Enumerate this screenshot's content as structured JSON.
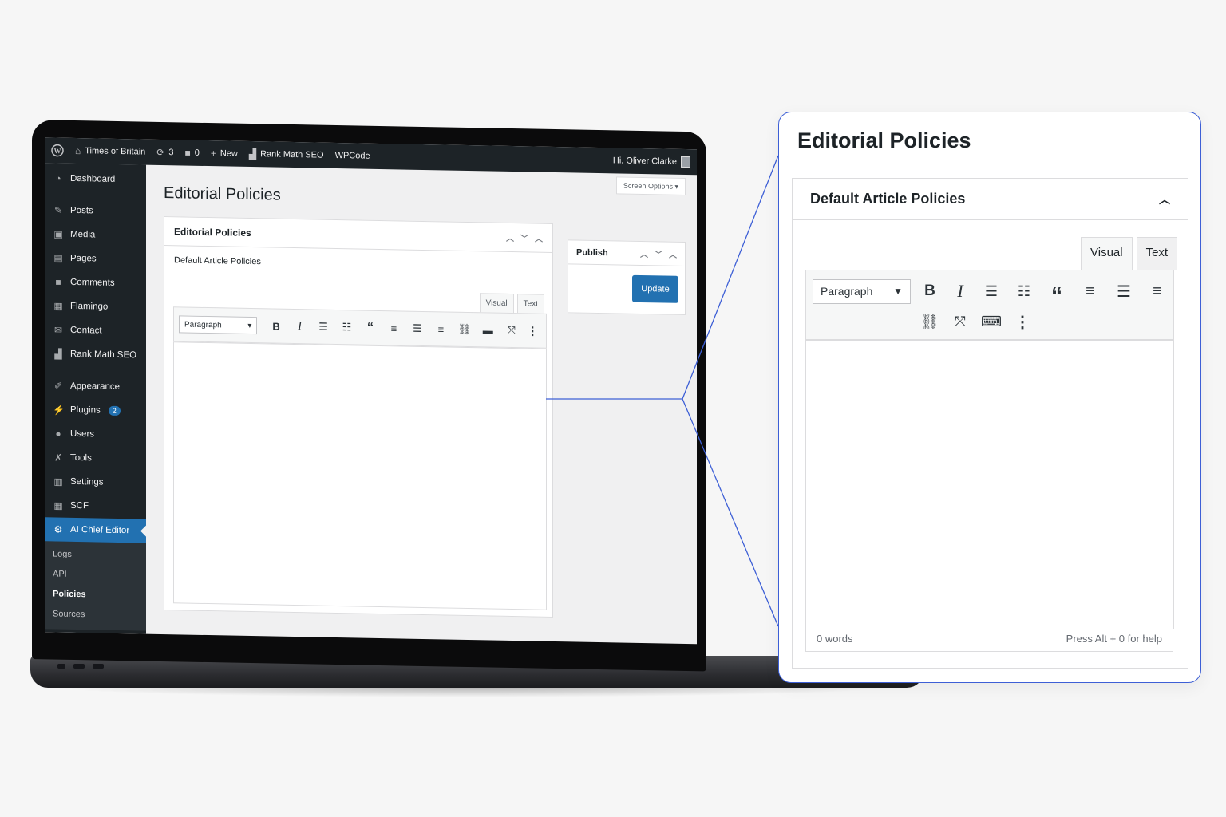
{
  "admin_bar": {
    "site_name": "Times of Britain",
    "updates_count": "3",
    "comments_count": "0",
    "new_label": "New",
    "rank_math_label": "Rank Math SEO",
    "wpcode_label": "WPCode",
    "greeting": "Hi, Oliver Clarke"
  },
  "sidebar": {
    "items": [
      {
        "label": "Dashboard",
        "icon": "dashboard-icon"
      },
      {
        "label": "Posts",
        "icon": "pin-icon"
      },
      {
        "label": "Media",
        "icon": "media-icon"
      },
      {
        "label": "Pages",
        "icon": "page-icon"
      },
      {
        "label": "Comments",
        "icon": "comment-icon"
      },
      {
        "label": "Flamingo",
        "icon": "flamingo-icon"
      },
      {
        "label": "Contact",
        "icon": "mail-icon"
      },
      {
        "label": "Rank Math SEO",
        "icon": "chart-icon"
      },
      {
        "label": "Appearance",
        "icon": "brush-icon"
      },
      {
        "label": "Plugins",
        "icon": "plug-icon",
        "badge": "2"
      },
      {
        "label": "Users",
        "icon": "user-icon"
      },
      {
        "label": "Tools",
        "icon": "wrench-icon"
      },
      {
        "label": "Settings",
        "icon": "settings-icon"
      },
      {
        "label": "SCF",
        "icon": "table-icon"
      },
      {
        "label": "AI Chief Editor",
        "icon": "gear-icon"
      }
    ],
    "submenu": [
      "Logs",
      "API",
      "Policies",
      "Sources"
    ],
    "active_submenu": "Policies"
  },
  "screen_options_label": "Screen Options",
  "page_title": "Editorial Policies",
  "postbox": {
    "title": "Editorial Policies",
    "field_label": "Default Article Policies"
  },
  "publish": {
    "title": "Publish",
    "update_label": "Update"
  },
  "editor": {
    "tab_visual": "Visual",
    "tab_text": "Text",
    "format_value": "Paragraph"
  },
  "callout": {
    "title": "Editorial Policies",
    "field_label": "Default Article Policies",
    "tab_visual": "Visual",
    "tab_text": "Text",
    "format_value": "Paragraph",
    "word_count": "0 words",
    "help_text": "Press Alt + 0 for help"
  },
  "colors": {
    "accent": "#2271b1",
    "callout_border": "#3d5fd6",
    "admin_dark": "#1d2327"
  }
}
